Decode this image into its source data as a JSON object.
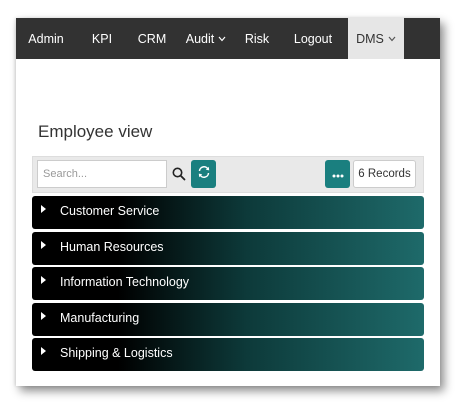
{
  "nav": {
    "items": [
      {
        "label": "Admin"
      },
      {
        "label": "KPI"
      },
      {
        "label": "CRM"
      },
      {
        "label": "Audit",
        "dropdown": true
      },
      {
        "label": "Risk"
      },
      {
        "label": "Logout"
      },
      {
        "label": "DMS",
        "dropdown": true,
        "active": true
      }
    ]
  },
  "page": {
    "title": "Employee view"
  },
  "toolbar": {
    "search_placeholder": "Search...",
    "search_icon": "search-icon",
    "refresh_icon": "refresh-icon",
    "more_icon": "ellipsis-icon",
    "records_label": "6 Records"
  },
  "departments": [
    {
      "label": "Customer Service"
    },
    {
      "label": "Human Resources"
    },
    {
      "label": "Information Technology"
    },
    {
      "label": "Manufacturing"
    },
    {
      "label": "Shipping & Logistics"
    }
  ],
  "colors": {
    "navbar": "#323232",
    "accent": "#1a7f7f",
    "row_dark": "#000000",
    "row_teal": "#1e6a6a"
  }
}
